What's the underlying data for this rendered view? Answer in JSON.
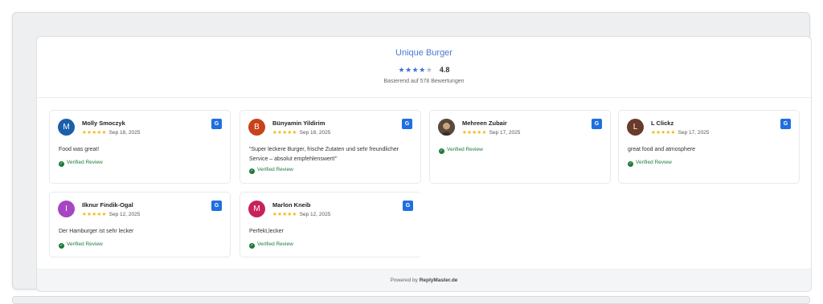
{
  "header": {
    "business_name": "Unique Burger",
    "stars_filled": "★★★★",
    "stars_empty": "★",
    "rating": "4.8",
    "based_on": "Basierend auf 578 Bewertungen"
  },
  "reviews": [
    {
      "initial": "M",
      "name": "Molly Smoczyk",
      "stars": "★★★★★",
      "date": "Sep 18, 2025",
      "text": "Food was great!",
      "verified": "Verified Review",
      "avatar_color": "#1b5fa8"
    },
    {
      "initial": "B",
      "name": "Bünyamin Yildirim",
      "stars": "★★★★★",
      "date": "Sep 18, 2025",
      "text": "\"Super leckere Burger, frische Zutaten und sehr freundlicher Service – absolut empfehlenswert!\"",
      "verified": "Verified Review",
      "avatar_color": "#c8421c"
    },
    {
      "initial": "",
      "name": "Mehreen Zubair",
      "stars": "★★★★★",
      "date": "Sep 17, 2025",
      "text": "",
      "verified": "Verified Review",
      "avatar_color": "#6b5b4a"
    },
    {
      "initial": "L",
      "name": "L Clickz",
      "stars": "★★★★★",
      "date": "Sep 17, 2025",
      "text": "great food and atmosphere",
      "verified": "Verified Review",
      "avatar_color": "#6a3b2a"
    },
    {
      "initial": "I",
      "name": "Ilknur Findik-Ogal",
      "stars": "★★★★★",
      "date": "Sep 12, 2025",
      "text": "Der Hamburger ist sehr lecker",
      "verified": "Verified Review",
      "avatar_color": "#a646c2"
    },
    {
      "initial": "M",
      "name": "Marlon Kneib",
      "stars": "★★★★★",
      "date": "Sep 12, 2025",
      "text": "Perfekt,lecker",
      "verified": "Verified Review",
      "avatar_color": "#c8225a"
    }
  ],
  "badge_label": "G",
  "check_glyph": "✓",
  "footer": {
    "powered_by": "Powered by",
    "brand": "ReplyMaster.de"
  }
}
